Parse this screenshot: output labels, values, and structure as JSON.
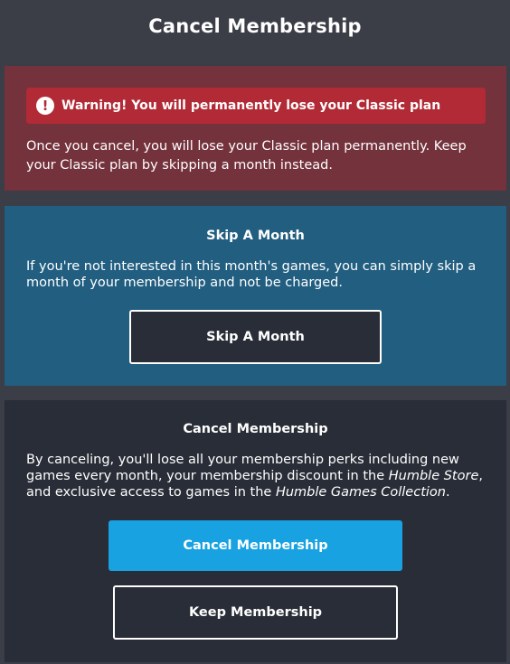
{
  "page": {
    "title": "Cancel Membership"
  },
  "warning": {
    "icon": "exclamation-circle-icon",
    "banner_text": "Warning! You will permanently lose your Classic plan",
    "body_text": "Once you cancel, you will lose your Classic plan permanently. Keep your Classic plan by skipping a month instead."
  },
  "skip": {
    "heading": "Skip A Month",
    "body_text": "If you're not interested in this month's games, you can simply skip a month of your membership and not be charged.",
    "button_label": "Skip A Month"
  },
  "cancel": {
    "heading": "Cancel Membership",
    "body_part1": "By canceling, you'll lose all your membership perks including new games every month, your membership discount in the ",
    "store_name": "Humble Store",
    "body_part2": ", and exclusive access to games in the ",
    "collection_name": "Humble Games Collection",
    "body_part3": ".",
    "cancel_button_label": "Cancel Membership",
    "keep_button_label": "Keep Membership"
  },
  "colors": {
    "background": "#3b3d47",
    "warning_card": "#74323c",
    "warning_banner": "#b12a35",
    "skip_card": "#215e80",
    "cancel_card": "#292d37",
    "primary_button": "#18a2e2"
  }
}
